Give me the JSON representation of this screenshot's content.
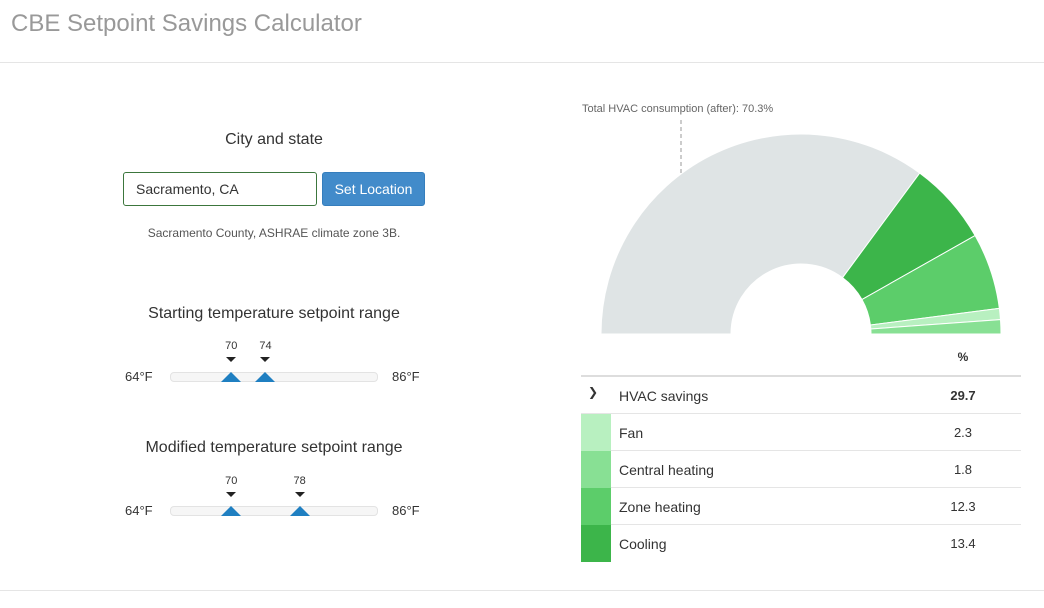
{
  "header": {
    "title": "CBE Setpoint Savings Calculator"
  },
  "location": {
    "section_title": "City and state",
    "input_value": "Sacramento, CA",
    "button_label": "Set Location",
    "info": "Sacramento County, ASHRAE climate zone 3B."
  },
  "starting_range": {
    "title": "Starting temperature setpoint range",
    "min_label": "64°F",
    "max_label": "86°F",
    "min": 64,
    "max": 86,
    "low": 70,
    "high": 74,
    "low_label": "70",
    "high_label": "74"
  },
  "modified_range": {
    "title": "Modified temperature setpoint range",
    "min_label": "64°F",
    "max_label": "86°F",
    "min": 64,
    "max": 86,
    "low": 70,
    "high": 78,
    "low_label": "70",
    "high_label": "78"
  },
  "chart": {
    "annotation": "Total HVAC consumption (after): 70.3%"
  },
  "chart_data": {
    "type": "pie",
    "categories": [
      "Total HVAC consumption (after)",
      "Cooling",
      "Zone heating",
      "Central heating",
      "Fan"
    ],
    "values": [
      70.3,
      13.4,
      12.3,
      1.8,
      2.3
    ],
    "colors": [
      "#dfe4e5",
      "#3cb54a",
      "#5ccd6a",
      "#b8f0c0",
      "#88e094"
    ],
    "shape": "half-donut"
  },
  "table": {
    "pct_header": "%",
    "summary": {
      "label": "HVAC savings",
      "value": "29.7"
    },
    "rows": [
      {
        "label": "Fan",
        "value": "2.3",
        "color": "#b8f0c0"
      },
      {
        "label": "Central heating",
        "value": "1.8",
        "color": "#88e094"
      },
      {
        "label": "Zone heating",
        "value": "12.3",
        "color": "#5ccd6a"
      },
      {
        "label": "Cooling",
        "value": "13.4",
        "color": "#3cb54a"
      }
    ]
  }
}
